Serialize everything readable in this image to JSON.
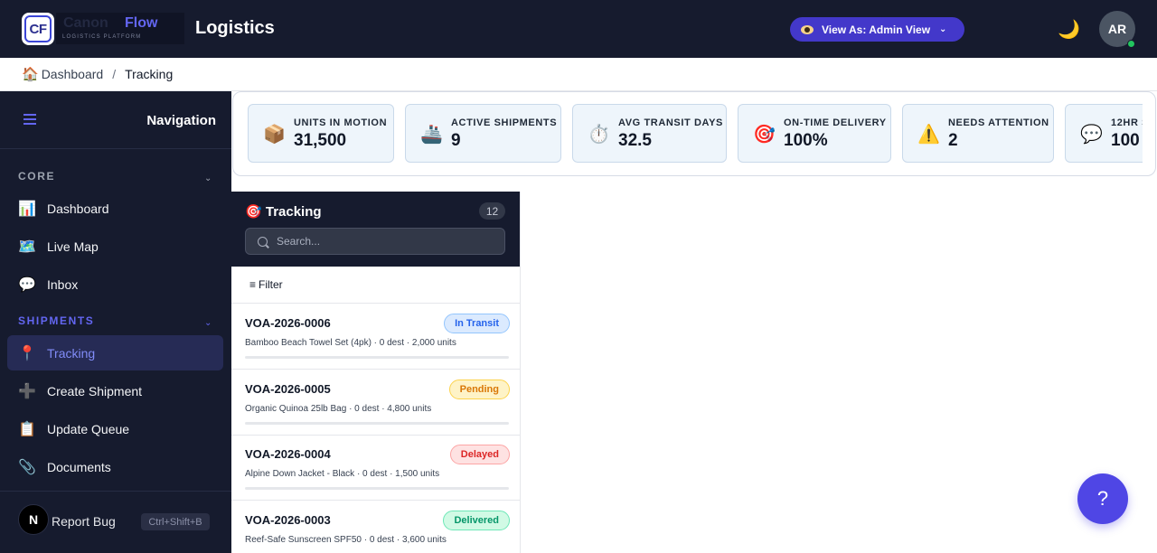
{
  "header": {
    "logo_mark": "CF",
    "logo_word": "Flow",
    "logo_word_ghost": "Canon",
    "logo_subtitle": "LOGISTICS PLATFORM",
    "title": "Logistics",
    "view_as_label": "View As: Admin View",
    "avatar_initials": "AR"
  },
  "breadcrumb": {
    "home": "Dashboard",
    "separator": "/",
    "current": "Tracking"
  },
  "sidebar": {
    "title": "Navigation",
    "sections": [
      {
        "label": "CORE",
        "color": "#9ca3af"
      },
      {
        "label": "SHIPMENTS",
        "color": "#6366f1"
      }
    ],
    "core_items": [
      {
        "label": "Dashboard",
        "icon": "📊"
      },
      {
        "label": "Live Map",
        "icon": "🗺️"
      },
      {
        "label": "Inbox",
        "icon": "💬"
      }
    ],
    "shipment_items": [
      {
        "label": "Tracking",
        "icon": "📍",
        "active": true
      },
      {
        "label": "Create Shipment",
        "icon": "➕"
      },
      {
        "label": "Update Queue",
        "icon": "📋"
      },
      {
        "label": "Documents",
        "icon": "📎"
      }
    ],
    "footer": {
      "avatar": "N",
      "report_bug": "Report Bug",
      "shortcut": "Ctrl+Shift+B"
    }
  },
  "kpis": [
    {
      "label": "UNITS IN MOTION",
      "value": "31,500",
      "icon": "📦"
    },
    {
      "label": "ACTIVE SHIPMENTS",
      "value": "9",
      "icon": "🚢"
    },
    {
      "label": "AVG TRANSIT DAYS",
      "value": "32.5",
      "icon": "⏱️"
    },
    {
      "label": "ON-TIME DELIVERY",
      "value": "100%",
      "icon": "🎯"
    },
    {
      "label": "NEEDS ATTENTION",
      "value": "2",
      "icon": "⚠️"
    },
    {
      "label": "12HR S",
      "value": "100",
      "icon": "💬"
    }
  ],
  "tracking": {
    "title": "Tracking",
    "title_icon": "🎯",
    "count": "12",
    "search_placeholder": "Search...",
    "filter_label": "Filter",
    "shipments": [
      {
        "id": "VOA-2026-0006",
        "desc": "Bamboo Beach Towel Set (4pk) · 0 dest · 2,000 units",
        "status": "In Transit",
        "status_color": "#2563eb",
        "status_bg": "#dbeafe",
        "status_border": "#93c5fd"
      },
      {
        "id": "VOA-2026-0005",
        "desc": "Organic Quinoa 25lb Bag · 0 dest · 4,800 units",
        "status": "Pending",
        "status_color": "#d97706",
        "status_bg": "#fef3c7",
        "status_border": "#fcd34d"
      },
      {
        "id": "VOA-2026-0004",
        "desc": "Alpine Down Jacket - Black · 0 dest · 1,500 units",
        "status": "Delayed",
        "status_color": "#dc2626",
        "status_bg": "#fee2e2",
        "status_border": "#fca5a5"
      },
      {
        "id": "VOA-2026-0003",
        "desc": "Reef-Safe Sunscreen SPF50 · 0 dest · 3,600 units",
        "status": "Delivered",
        "status_color": "#059669",
        "status_bg": "#d1fae5",
        "status_border": "#6ee7b7"
      }
    ]
  },
  "help_label": "?"
}
